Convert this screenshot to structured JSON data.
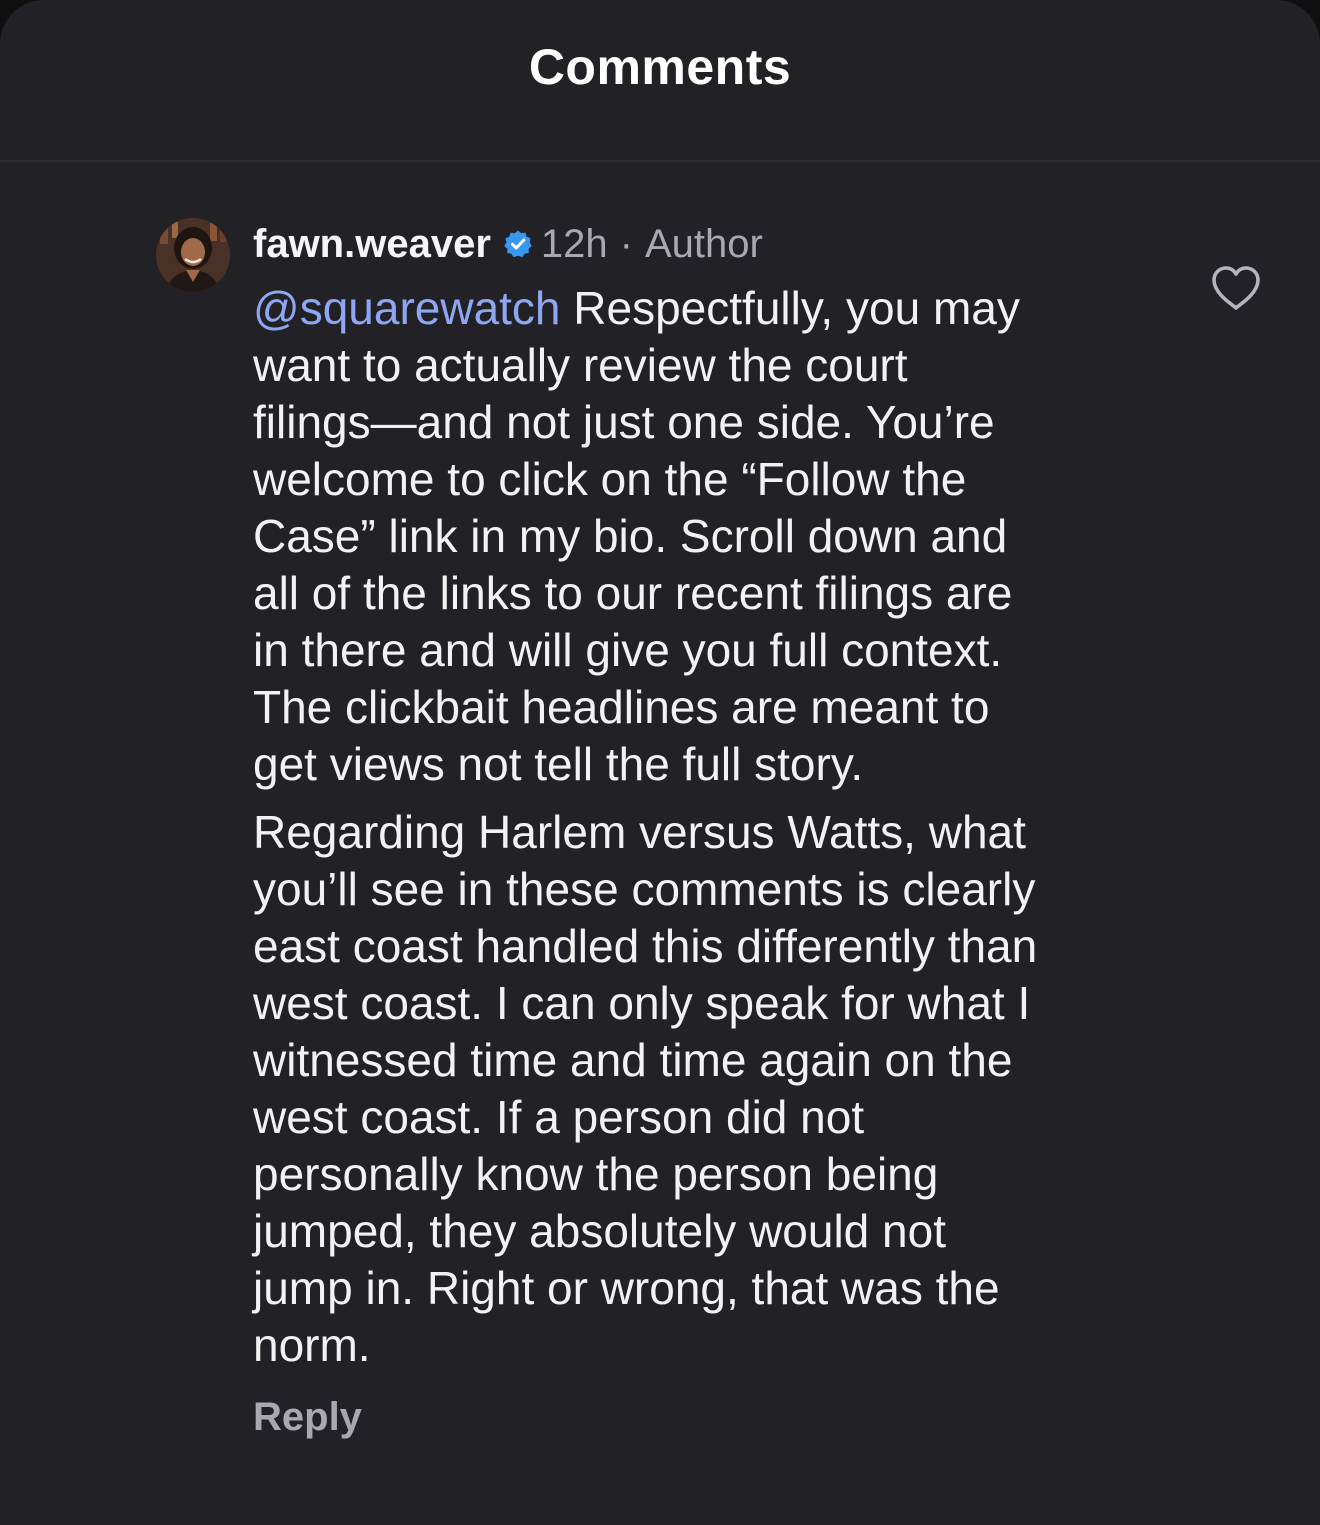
{
  "header": {
    "title": "Comments"
  },
  "comment": {
    "avatar_icon": "profile-photo",
    "username": "fawn.weaver",
    "verified_icon": "verified-badge-icon",
    "verified_color": "#3897f0",
    "time": "12h",
    "separator": "·",
    "role": "Author",
    "like_icon": "heart-outline-icon",
    "mention": "@squarewatch",
    "paragraph1_lines": [
      "Respectfully, you may",
      "want to actually review the court",
      "filings—and not just one side. You’re",
      "welcome to click on the “Follow the",
      "Case” link in my bio. Scroll down and",
      "all of the links to our recent filings are",
      "in there and will give you full context.",
      "The clickbait headlines are meant to",
      "get views not tell the full story."
    ],
    "paragraph2_lines": [
      "Regarding Harlem versus Watts, what",
      "you’ll see in these comments is clearly",
      "east coast handled this differently than",
      "west coast. I can only speak for what I",
      "witnessed time and time again on the",
      "west coast. If a person did not",
      "personally know the person being",
      "jumped, they absolutely would not",
      "jump in. Right or wrong, that was the",
      "norm."
    ],
    "reply_label": "Reply"
  },
  "colors": {
    "background": "#222226",
    "text": "#f2f2f2",
    "muted": "#a8a8ae",
    "mention": "#8fa7f2"
  }
}
